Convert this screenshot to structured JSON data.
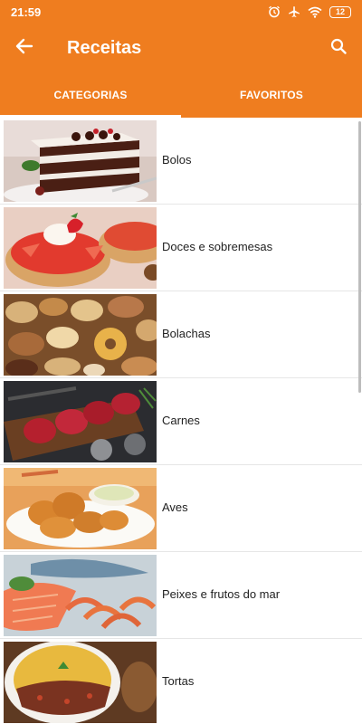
{
  "status_bar": {
    "time": "21:59",
    "battery_level": "12",
    "icons": [
      "alarm-icon",
      "airplane-mode-icon",
      "wifi-icon",
      "battery-icon"
    ]
  },
  "app_bar": {
    "title": "Receitas",
    "back_icon": "arrow-left-icon",
    "search_icon": "search-icon"
  },
  "tabs": [
    {
      "label": "CATEGORIAS",
      "active": true
    },
    {
      "label": "FAVORITOS",
      "active": false
    }
  ],
  "categories": [
    {
      "label": "Bolos",
      "image": "cake-slice"
    },
    {
      "label": "Doces e sobremesas",
      "image": "strawberry-tart"
    },
    {
      "label": "Bolachas",
      "image": "cookies"
    },
    {
      "label": "Carnes",
      "image": "raw-steaks"
    },
    {
      "label": "Aves",
      "image": "fried-chicken"
    },
    {
      "label": "Peixes e frutos do mar",
      "image": "salmon-and-shrimp"
    },
    {
      "label": "Tortas",
      "image": "savory-pie"
    }
  ],
  "colors": {
    "primary": "#ef7d1f",
    "on_primary": "#ffffff",
    "divider": "#e6e6e6",
    "text": "#222222"
  }
}
